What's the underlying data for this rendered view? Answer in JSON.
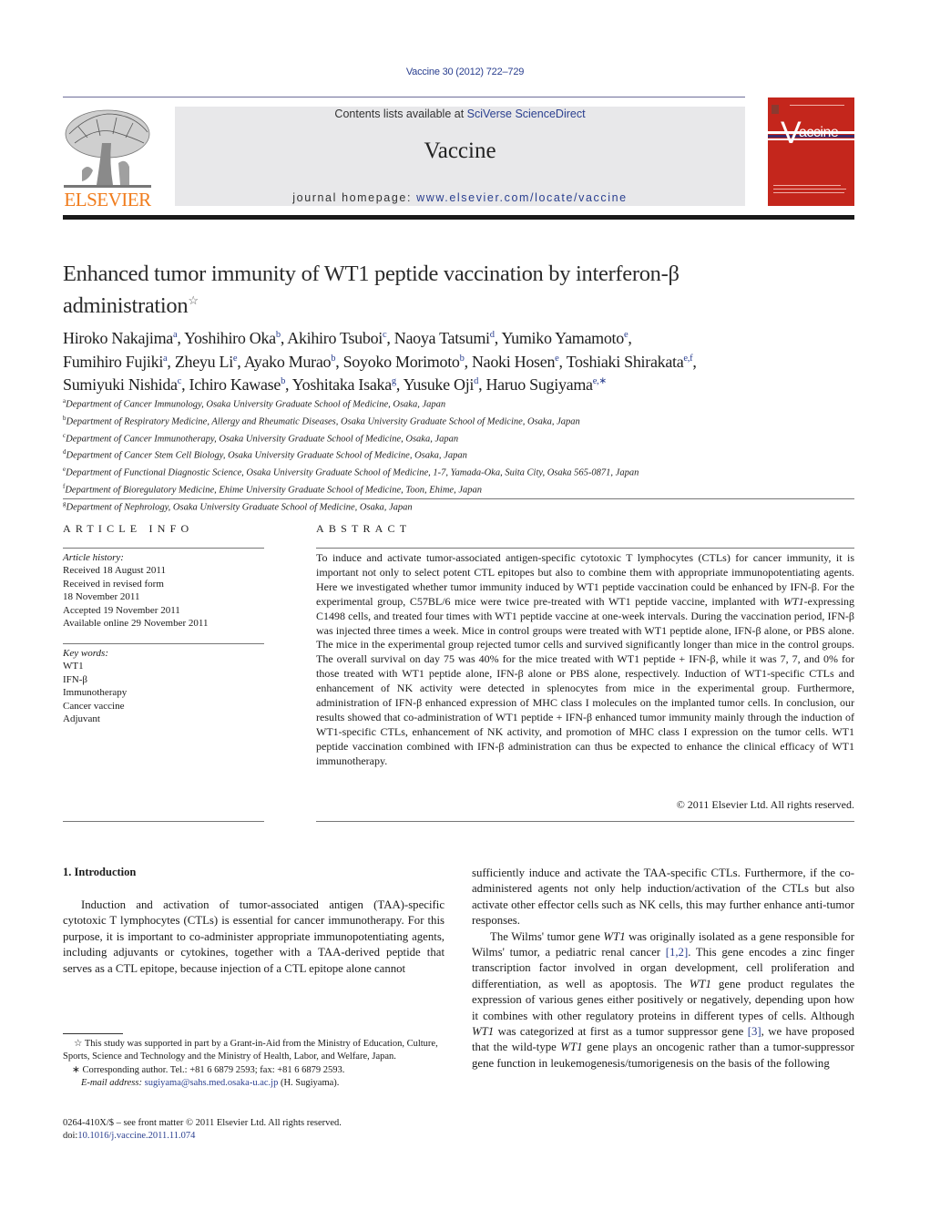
{
  "header": {
    "citation": "Vaccine 30 (2012) 722–729",
    "publisher_logo": "ELSEVIER",
    "contents_prefix": "Contents lists available at ",
    "contents_link": "SciVerse ScienceDirect",
    "journal_title": "Vaccine",
    "homepage_prefix": "journal homepage: ",
    "homepage_link": "www.elsevier.com/locate/vaccine",
    "cover_title": "accine",
    "cover_initial": "V"
  },
  "article": {
    "title_line1": "Enhanced tumor immunity of WT1 peptide vaccination by interferon-β",
    "title_line2": "administration",
    "title_note_mark": "☆",
    "authors": [
      {
        "name": "Hiroko Nakajima",
        "aff": "a"
      },
      {
        "name": "Yoshihiro Oka",
        "aff": "b"
      },
      {
        "name": "Akihiro Tsuboi",
        "aff": "c"
      },
      {
        "name": "Naoya Tatsumi",
        "aff": "d"
      },
      {
        "name": "Yumiko Yamamoto",
        "aff": "e"
      },
      {
        "name": "Fumihiro Fujiki",
        "aff": "a"
      },
      {
        "name": "Zheyu Li",
        "aff": "e"
      },
      {
        "name": "Ayako Murao",
        "aff": "b"
      },
      {
        "name": "Soyoko Morimoto",
        "aff": "b"
      },
      {
        "name": "Naoki Hosen",
        "aff": "e"
      },
      {
        "name": "Toshiaki Shirakata",
        "aff": "e,f"
      },
      {
        "name": "Sumiyuki Nishida",
        "aff": "c"
      },
      {
        "name": "Ichiro Kawase",
        "aff": "b"
      },
      {
        "name": "Yoshitaka Isaka",
        "aff": "g"
      },
      {
        "name": "Yusuke Oji",
        "aff": "d"
      },
      {
        "name": "Haruo Sugiyama",
        "aff": "e,∗"
      }
    ],
    "affiliations": [
      {
        "mark": "a",
        "text": "Department of Cancer Immunology, Osaka University Graduate School of Medicine, Osaka, Japan"
      },
      {
        "mark": "b",
        "text": "Department of Respiratory Medicine, Allergy and Rheumatic Diseases, Osaka University Graduate School of Medicine, Osaka, Japan"
      },
      {
        "mark": "c",
        "text": "Department of Cancer Immunotherapy, Osaka University Graduate School of Medicine, Osaka, Japan"
      },
      {
        "mark": "d",
        "text": "Department of Cancer Stem Cell Biology, Osaka University Graduate School of Medicine, Osaka, Japan"
      },
      {
        "mark": "e",
        "text": "Department of Functional Diagnostic Science, Osaka University Graduate School of Medicine, 1-7, Yamada-Oka, Suita City, Osaka 565-0871, Japan"
      },
      {
        "mark": "f",
        "text": "Department of Bioregulatory Medicine, Ehime University Graduate School of Medicine, Toon, Ehime, Japan"
      },
      {
        "mark": "g",
        "text": "Department of Nephrology, Osaka University Graduate School of Medicine, Osaka, Japan"
      }
    ]
  },
  "article_info": {
    "heading": "ARTICLE INFO",
    "history_label": "Article history:",
    "history": [
      "Received 18 August 2011",
      "Received in revised form",
      "18 November 2011",
      "Accepted 19 November 2011",
      "Available online 29 November 2011"
    ],
    "keywords_label": "Key words:",
    "keywords": [
      "WT1",
      "IFN-β",
      "Immunotherapy",
      "Cancer vaccine",
      "Adjuvant"
    ]
  },
  "abstract": {
    "heading": "ABSTRACT",
    "text_a": "To induce and activate tumor-associated antigen-specific cytotoxic T lymphocytes (CTLs) for cancer immunity, it is important not only to select potent CTL epitopes but also to combine them with appropriate immunopotentiating agents. Here we investigated whether tumor immunity induced by WT1 peptide vaccination could be enhanced by IFN-β. For the experimental group, C57BL/6 mice were twice pre-treated with WT1 peptide vaccine, implanted with ",
    "text_gene": "WT1",
    "text_b": "-expressing C1498 cells, and treated four times with WT1 peptide vaccine at one-week intervals. During the vaccination period, IFN-β was injected three times a week. Mice in control groups were treated with WT1 peptide alone, IFN-β alone, or PBS alone. The mice in the experimental group rejected tumor cells and survived significantly longer than mice in the control groups. The overall survival on day 75 was 40% for the mice treated with WT1 peptide + IFN-β, while it was 7, 7, and 0% for those treated with WT1 peptide alone, IFN-β alone or PBS alone, respectively. Induction of WT1-specific CTLs and enhancement of NK activity were detected in splenocytes from mice in the experimental group. Furthermore, administration of IFN-β enhanced expression of MHC class I molecules on the implanted tumor cells. In conclusion, our results showed that co-administration of WT1 peptide + IFN-β enhanced tumor immunity mainly through the induction of WT1-specific CTLs, enhancement of NK activity, and promotion of MHC class I expression on the tumor cells. WT1 peptide vaccination combined with IFN-β administration can thus be expected to enhance the clinical efficacy of WT1 immunotherapy.",
    "copyright": "© 2011 Elsevier Ltd. All rights reserved."
  },
  "body": {
    "section_heading": "1.  Introduction",
    "left_para": "Induction and activation of tumor-associated antigen (TAA)-specific cytotoxic T lymphocytes (CTLs) is essential for cancer immunotherapy. For this purpose, it is important to co-administer appropriate immunopotentiating agents, including adjuvants or cytokines, together with a TAA-derived peptide that serves as a CTL epitope, because injection of a CTL epitope alone cannot",
    "right_para1": "sufficiently induce and activate the TAA-specific CTLs. Furthermore, if the co-administered agents not only help induction/activation of the CTLs but also activate other effector cells such as NK cells, this may further enhance anti-tumor responses.",
    "right_para2_a": "The Wilms' tumor gene ",
    "right_para2_gene1": "WT1",
    "right_para2_b": " was originally isolated as a gene responsible for Wilms' tumor, a pediatric renal cancer ",
    "ref1": "[1,2]",
    "right_para2_c": ". This gene encodes a zinc finger transcription factor involved in organ development, cell proliferation and differentiation, as well as apoptosis. The ",
    "right_para2_gene2": "WT1",
    "right_para2_d": " gene product regulates the expression of various genes either positively or negatively, depending upon how it combines with other regulatory proteins in different types of cells. Although ",
    "right_para2_gene3": "WT1",
    "right_para2_e": " was categorized at first as a tumor suppressor gene ",
    "ref2": "[3]",
    "right_para2_f": ", we have proposed that the wild-type ",
    "right_para2_gene4": "WT1",
    "right_para2_g": " gene plays an oncogenic rather than a tumor-suppressor gene function in leukemogenesis/tumorigenesis on the basis of the following"
  },
  "footnotes": {
    "funding_mark": "☆",
    "funding": "This study was supported in part by a Grant-in-Aid from the Ministry of Education, Culture, Sports, Science and Technology and the Ministry of Health, Labor, and Welfare, Japan.",
    "corr_mark": "∗",
    "corresponding": "Corresponding author. Tel.: +81 6 6879 2593; fax: +81 6 6879 2593.",
    "email_label": "E-mail address:",
    "email": "sugiyama@sahs.med.osaka-u.ac.jp",
    "email_owner": "(H. Sugiyama).",
    "front_matter": "0264-410X/$ – see front matter © 2011 Elsevier Ltd. All rights reserved.",
    "doi_prefix": "doi:",
    "doi": "10.1016/j.vaccine.2011.11.074"
  },
  "colors": {
    "link": "#2a3f8f",
    "elsevier_orange": "#f07c1c",
    "cover_red": "#c4261c",
    "banner_gray": "#e8e8ea"
  }
}
